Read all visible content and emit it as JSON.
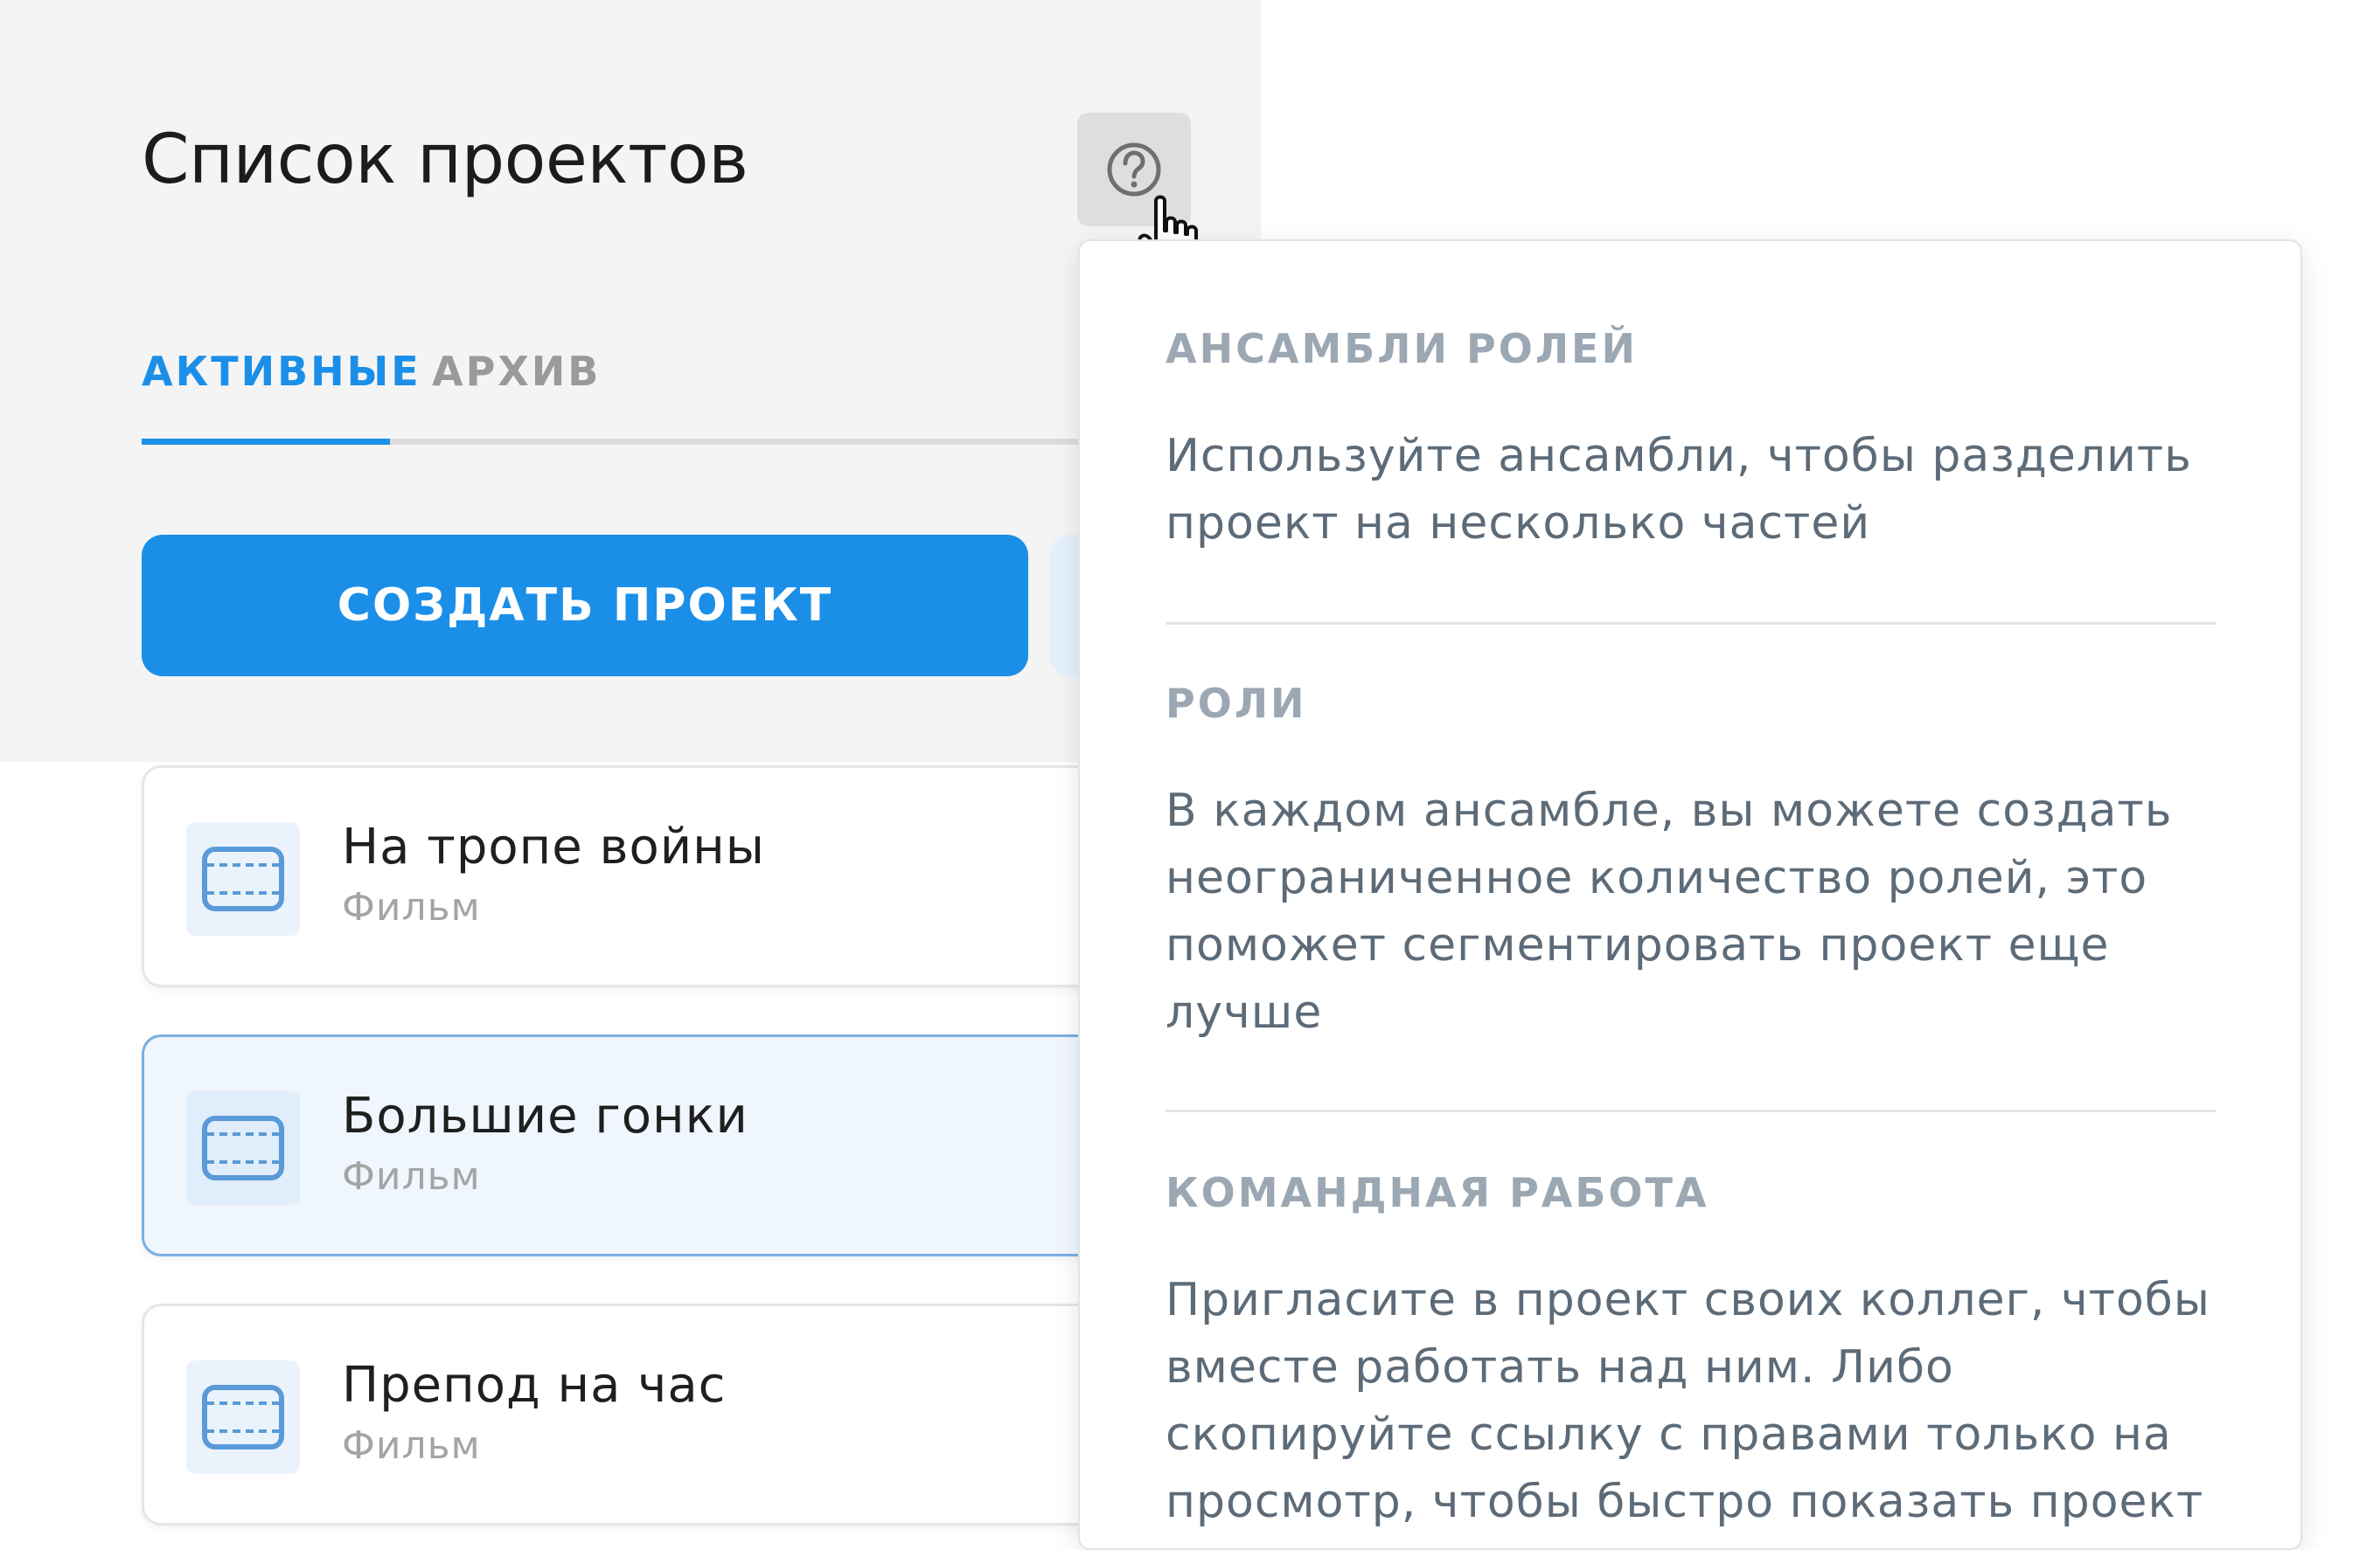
{
  "header": {
    "title": "Список проектов",
    "help_icon": "question-circle-icon"
  },
  "tabs": [
    {
      "label": "АКТИВНЫЕ",
      "active": true
    },
    {
      "label": "АРХИВ",
      "active": false
    }
  ],
  "actions": {
    "create_label": "СОЗДАТЬ ПРОЕКТ"
  },
  "projects": [
    {
      "title": "На тропе войны",
      "type": "Фильм",
      "icon": "film-icon",
      "selected": false
    },
    {
      "title": "Большие гонки",
      "type": "Фильм",
      "icon": "film-icon",
      "selected": true
    },
    {
      "title": "Препод на час",
      "type": "Фильм",
      "icon": "film-icon",
      "selected": false
    }
  ],
  "help_popover": {
    "sections": [
      {
        "heading": "АНСАМБЛИ РОЛЕЙ",
        "text": "Используйте ансамбли, чтобы разделить проект на несколько частей"
      },
      {
        "heading": "РОЛИ",
        "text": "В каждом ансамбле, вы можете создать неограниченное количество ролей, это поможет сегментировать проект еще лучше"
      },
      {
        "heading": "КОМАНДНАЯ РАБОТА",
        "text": "Пригласите в проект своих коллег, чтобы вместе работать над ним. Либо скопируйте ссылку с правами только на просмотр, чтобы быстро показать проект"
      }
    ]
  },
  "colors": {
    "accent": "#1b8fe8",
    "panel_bg": "#f4f4f4",
    "muted_heading": "#9ba7b3",
    "body_text": "#5d6b78",
    "selected_card_bg": "#f0f6fd",
    "selected_card_border": "#7ab0e2"
  }
}
